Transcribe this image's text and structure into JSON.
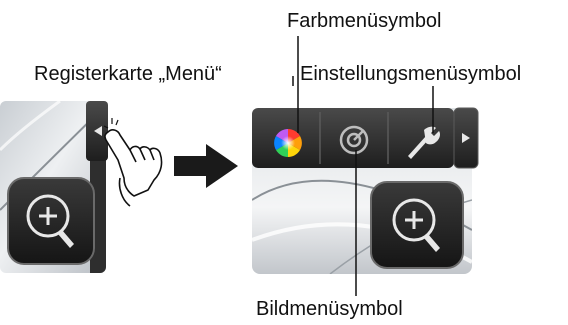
{
  "labels": {
    "menu_tab": "Registerkarte „Menü“",
    "color_menu_icon": "Farbmenüsymbol",
    "settings_menu_icon": "Einstellungsmenüsymbol",
    "image_menu_icon": "Bildmenüsymbol"
  },
  "icons": {
    "left_tab": "left-arrow-icon",
    "zoom": "zoom-in-icon",
    "color": "color-wheel-icon",
    "image": "target-icon",
    "settings": "wrench-icon",
    "right_tab": "right-arrow-icon",
    "hand": "pointing-hand-icon",
    "arrow": "right-arrow-pointer"
  },
  "colors": {
    "panel_dark": "#2a2a2a",
    "metal_light": "#e6e8ea",
    "arrow": "#1a1a1a"
  }
}
